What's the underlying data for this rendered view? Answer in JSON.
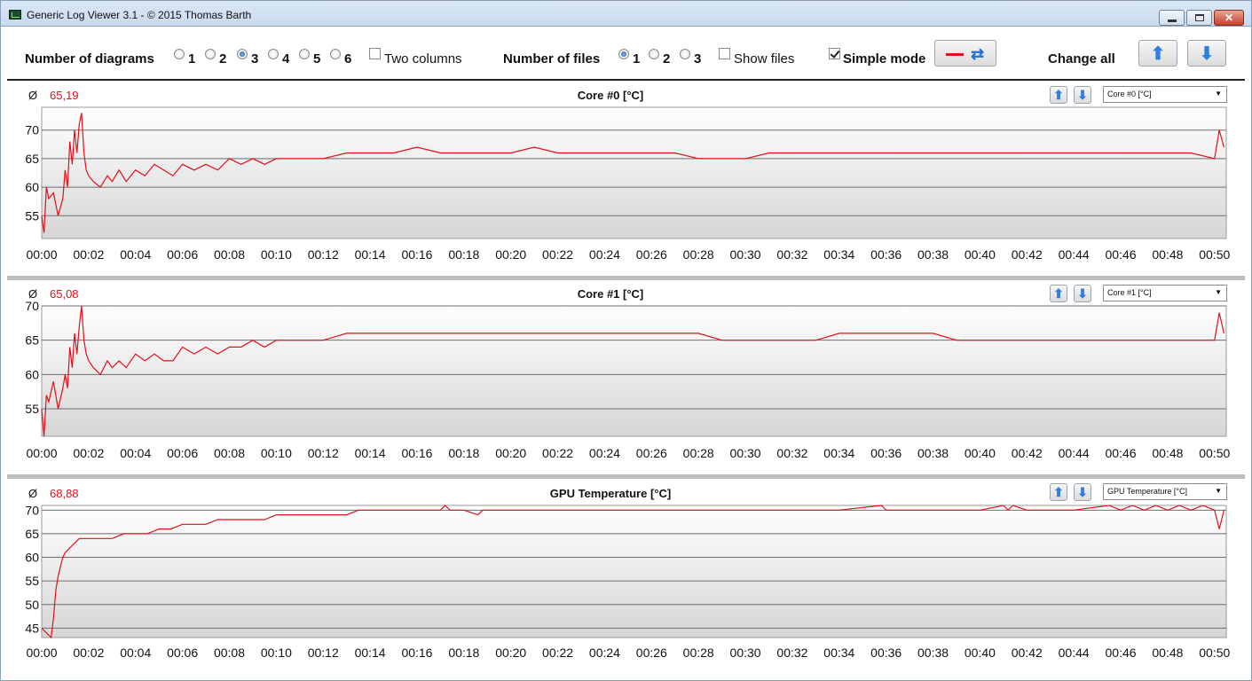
{
  "window": {
    "title": "Generic Log Viewer 3.1 - © 2015 Thomas Barth",
    "minimize_icon": "minimize-icon",
    "maximize_icon": "maximize-icon",
    "close_icon": "close-icon"
  },
  "toolbar": {
    "diagrams_label": "Number of diagrams",
    "diagram_options": [
      "1",
      "2",
      "3",
      "4",
      "5",
      "6"
    ],
    "diagram_selected": "3",
    "two_columns_label": "Two columns",
    "two_columns_checked": false,
    "files_label": "Number of files",
    "file_options": [
      "1",
      "2",
      "3"
    ],
    "file_selected": "1",
    "show_files_label": "Show files",
    "show_files_checked": false,
    "simple_mode_label": "Simple mode",
    "simple_mode_checked": true,
    "change_all_label": "Change all",
    "line_color": "#e0101a",
    "accent_color": "#2f7fe0"
  },
  "x_ticks": [
    "00:00",
    "00:02",
    "00:04",
    "00:06",
    "00:08",
    "00:10",
    "00:12",
    "00:14",
    "00:16",
    "00:18",
    "00:20",
    "00:22",
    "00:24",
    "00:26",
    "00:28",
    "00:30",
    "00:32",
    "00:34",
    "00:36",
    "00:38",
    "00:40",
    "00:42",
    "00:44",
    "00:46",
    "00:48",
    "00:50"
  ],
  "avg_symbol": "Ø",
  "chart_data": [
    {
      "type": "line",
      "title": "Core #0 [°C]",
      "average": "65,19",
      "select_value": "Core #0 [°C]",
      "y_ticks": [
        "70",
        "65",
        "60",
        "55"
      ],
      "ylim": [
        51,
        74
      ],
      "xlim_minutes": [
        0,
        50.5
      ],
      "series": [
        {
          "x": [
            0,
            0.1,
            0.2,
            0.3,
            0.5,
            0.7,
            0.9,
            1.0,
            1.1,
            1.2,
            1.3,
            1.4,
            1.5,
            1.6,
            1.7,
            1.8,
            1.9,
            2.0,
            2.2,
            2.5,
            2.8,
            3.0,
            3.3,
            3.6,
            4.0,
            4.4,
            4.8,
            5.2,
            5.6,
            6.0,
            6.5,
            7.0,
            7.5,
            8.0,
            8.5,
            9.0,
            9.5,
            10.0,
            11,
            12,
            13,
            14,
            15,
            16,
            17,
            18,
            19,
            20,
            21,
            22,
            23,
            24,
            25,
            26,
            27,
            28,
            29,
            30,
            31,
            32,
            33,
            34,
            35,
            36,
            37,
            38,
            39,
            40,
            41,
            42,
            43,
            44,
            45,
            46,
            47,
            48,
            49,
            50,
            50.2,
            50.4
          ],
          "y": [
            55,
            52,
            60,
            58,
            59,
            55,
            58,
            63,
            60,
            68,
            64,
            70,
            66,
            71,
            73,
            66,
            63,
            62,
            61,
            60,
            62,
            61,
            63,
            61,
            63,
            62,
            64,
            63,
            62,
            64,
            63,
            64,
            63,
            65,
            64,
            65,
            64,
            65,
            65,
            65,
            66,
            66,
            66,
            67,
            66,
            66,
            66,
            66,
            67,
            66,
            66,
            66,
            66,
            66,
            66,
            65,
            65,
            65,
            66,
            66,
            66,
            66,
            66,
            66,
            66,
            66,
            66,
            66,
            66,
            66,
            66,
            66,
            66,
            66,
            66,
            66,
            66,
            65,
            70,
            67
          ]
        }
      ]
    },
    {
      "type": "line",
      "title": "Core #1 [°C]",
      "average": "65,08",
      "select_value": "Core #1 [°C]",
      "y_ticks": [
        "70",
        "65",
        "60",
        "55"
      ],
      "ylim": [
        51,
        70
      ],
      "xlim_minutes": [
        0,
        50.5
      ],
      "series": [
        {
          "x": [
            0,
            0.1,
            0.2,
            0.3,
            0.5,
            0.7,
            0.9,
            1.0,
            1.1,
            1.2,
            1.3,
            1.4,
            1.5,
            1.6,
            1.7,
            1.8,
            1.9,
            2.0,
            2.2,
            2.5,
            2.8,
            3.0,
            3.3,
            3.6,
            4.0,
            4.4,
            4.8,
            5.2,
            5.6,
            6.0,
            6.5,
            7.0,
            7.5,
            8.0,
            8.5,
            9.0,
            9.5,
            10.0,
            11,
            12,
            13,
            14,
            15,
            16,
            17,
            18,
            19,
            20,
            21,
            22,
            23,
            24,
            25,
            26,
            27,
            28,
            29,
            30,
            31,
            32,
            33,
            34,
            35,
            36,
            37,
            38,
            39,
            40,
            41,
            42,
            43,
            44,
            45,
            46,
            47,
            48,
            49,
            50,
            50.2,
            50.4
          ],
          "y": [
            55,
            51,
            57,
            56,
            59,
            55,
            58,
            60,
            58,
            64,
            61,
            66,
            63,
            67,
            70,
            65,
            63,
            62,
            61,
            60,
            62,
            61,
            62,
            61,
            63,
            62,
            63,
            62,
            62,
            64,
            63,
            64,
            63,
            64,
            64,
            65,
            64,
            65,
            65,
            65,
            66,
            66,
            66,
            66,
            66,
            66,
            66,
            66,
            66,
            66,
            66,
            66,
            66,
            66,
            66,
            66,
            65,
            65,
            65,
            65,
            65,
            66,
            66,
            66,
            66,
            66,
            65,
            65,
            65,
            65,
            65,
            65,
            65,
            65,
            65,
            65,
            65,
            65,
            69,
            66
          ]
        }
      ]
    },
    {
      "type": "line",
      "title": "GPU Temperature [°C]",
      "average": "68,88",
      "select_value": "GPU Temperature [°C]",
      "y_ticks": [
        "70",
        "65",
        "60",
        "55",
        "50",
        "45"
      ],
      "ylim": [
        43,
        71
      ],
      "xlim_minutes": [
        0,
        50.5
      ],
      "series": [
        {
          "x": [
            0,
            0.2,
            0.4,
            0.5,
            0.6,
            0.7,
            0.8,
            0.9,
            1.0,
            1.2,
            1.4,
            1.6,
            1.8,
            2.0,
            2.5,
            3.0,
            3.5,
            4.0,
            4.5,
            5.0,
            5.5,
            6.0,
            6.5,
            7.0,
            7.5,
            8.0,
            8.5,
            9.0,
            9.5,
            10.0,
            10.5,
            11,
            12,
            13,
            13.5,
            14,
            15,
            16,
            17,
            17.2,
            17.4,
            18,
            18.6,
            18.8,
            19,
            20,
            22,
            24,
            26,
            28,
            30,
            32,
            34,
            35.8,
            36,
            38,
            40,
            41,
            41.2,
            41.4,
            42,
            44,
            45.5,
            46,
            46.5,
            47,
            47.5,
            48,
            48.5,
            49,
            49.5,
            50,
            50.2,
            50.4
          ],
          "y": [
            45,
            44,
            43,
            47,
            53,
            56,
            58,
            60,
            61,
            62,
            63,
            64,
            64,
            64,
            64,
            64,
            65,
            65,
            65,
            66,
            66,
            67,
            67,
            67,
            68,
            68,
            68,
            68,
            68,
            69,
            69,
            69,
            69,
            69,
            70,
            70,
            70,
            70,
            70,
            71,
            70,
            70,
            69,
            70,
            70,
            70,
            70,
            70,
            70,
            70,
            70,
            70,
            70,
            71,
            70,
            70,
            70,
            71,
            70,
            71,
            70,
            70,
            71,
            70,
            71,
            70,
            71,
            70,
            71,
            70,
            71,
            70,
            66,
            70
          ]
        }
      ]
    }
  ]
}
